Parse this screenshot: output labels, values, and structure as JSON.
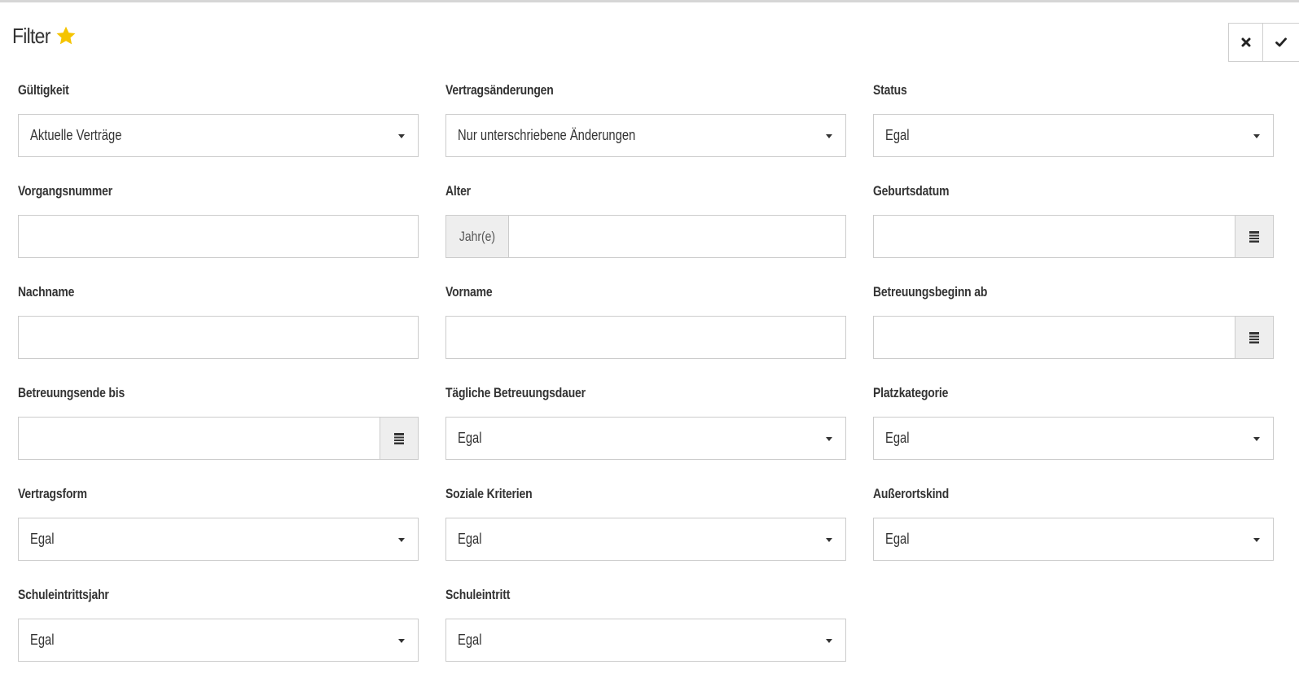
{
  "header": {
    "title": "Filter",
    "star_icon": "star-icon",
    "star_color": "#f5c400"
  },
  "actions": {
    "cancel_icon": "close-icon",
    "apply_icon": "check-icon"
  },
  "fields": {
    "gueltigkeit": {
      "label": "Gültigkeit",
      "value": "Aktuelle Verträge"
    },
    "vertragsaenderungen": {
      "label": "Vertragsänderungen",
      "value": "Nur unterschriebene Änderungen"
    },
    "status": {
      "label": "Status",
      "value": "Egal"
    },
    "vorgangsnummer": {
      "label": "Vorgangsnummer",
      "value": ""
    },
    "alter": {
      "label": "Alter",
      "addon": "Jahr(e)",
      "value": ""
    },
    "geburtsdatum": {
      "label": "Geburtsdatum",
      "value": ""
    },
    "nachname": {
      "label": "Nachname",
      "value": ""
    },
    "vorname": {
      "label": "Vorname",
      "value": ""
    },
    "betreuungsbeginn": {
      "label": "Betreuungsbeginn ab",
      "value": ""
    },
    "betreuungsende": {
      "label": "Betreuungsende bis",
      "value": ""
    },
    "betreuungsdauer": {
      "label": "Tägliche Betreuungsdauer",
      "value": "Egal"
    },
    "platzkategorie": {
      "label": "Platzkategorie",
      "value": "Egal"
    },
    "vertragsform": {
      "label": "Vertragsform",
      "value": "Egal"
    },
    "soziale_kriterien": {
      "label": "Soziale Kriterien",
      "value": "Egal"
    },
    "ausserortskind": {
      "label": "Außerortskind",
      "value": "Egal"
    },
    "schuleintrittsjahr": {
      "label": "Schuleintrittsjahr",
      "value": "Egal"
    },
    "schuleintritt": {
      "label": "Schuleintritt",
      "value": "Egal"
    }
  }
}
